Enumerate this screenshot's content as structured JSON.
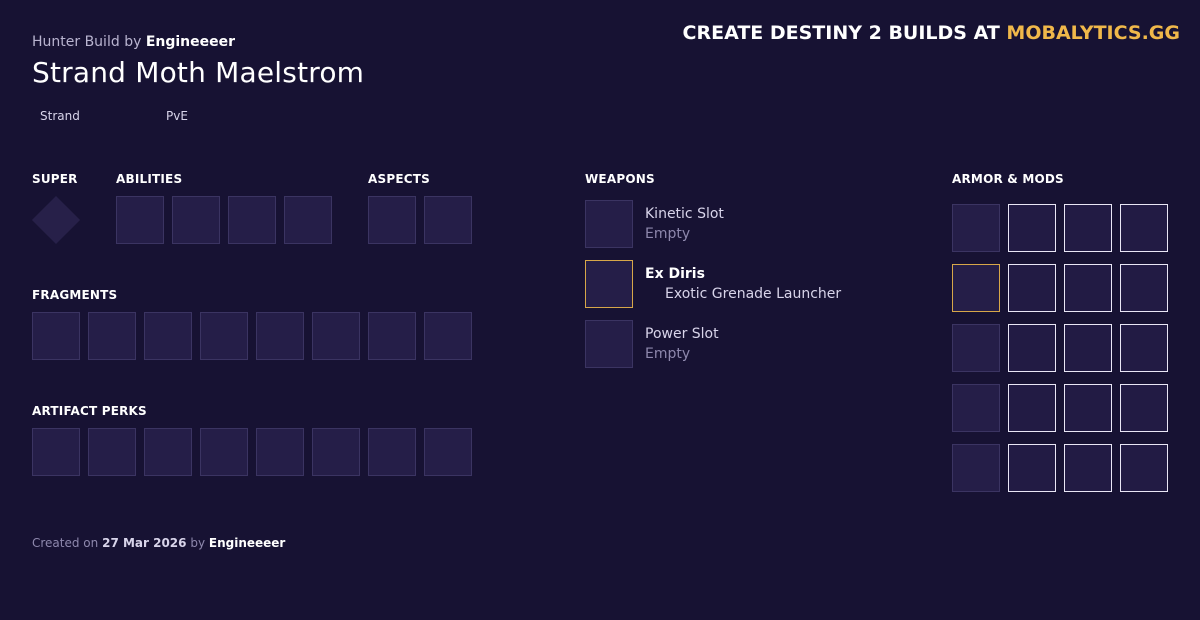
{
  "header": {
    "subtitle_prefix": "Hunter Build",
    "by_word": "by",
    "author": "Engineeeer",
    "title": "Strand Moth Maelstrom"
  },
  "promo": {
    "text": "CREATE DESTINY 2 BUILDS AT",
    "brand": "MOBALYTICS.GG",
    "brand_color": "#f0b84a"
  },
  "tags": [
    "Strand",
    "PvE"
  ],
  "sections": {
    "super": "SUPER",
    "abilities": "ABILITIES",
    "aspects": "ASPECTS",
    "fragments": "FRAGMENTS",
    "artifact_perks": "ARTIFACT PERKS",
    "weapons": "WEAPONS",
    "armor_mods": "ARMOR & MODS"
  },
  "weapons": [
    {
      "name": "Kinetic Slot",
      "detail": "Empty"
    },
    {
      "name": "Ex Diris",
      "detail": "Exotic Grenade Launcher"
    },
    {
      "name": "Power Slot",
      "detail": "Empty"
    }
  ],
  "footer": {
    "prefix": "Created on",
    "date": "27 Mar 2026",
    "by_word": "by",
    "author": "Engineeeer"
  },
  "colors": {
    "background": "#171233",
    "slot": "#251e48",
    "exotic_border": "#d7a749"
  }
}
